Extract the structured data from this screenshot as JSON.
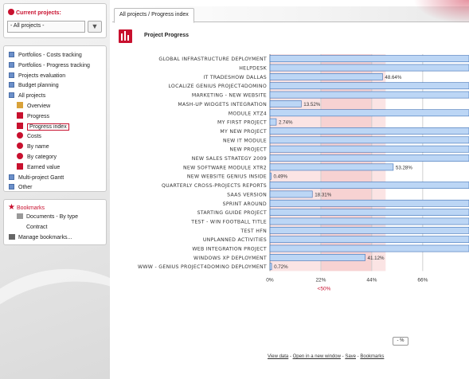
{
  "sidebar": {
    "current_projects_label": "Current projects:",
    "project_select_value": "- All projects -",
    "nav_items": [
      {
        "label": "Portfolios - Costs tracking",
        "level": 0
      },
      {
        "label": "Portfolios - Progress tracking",
        "level": 0
      },
      {
        "label": "Projects evaluation",
        "level": 0
      },
      {
        "label": "Budget planning",
        "level": 0
      },
      {
        "label": "All projects",
        "level": 0
      },
      {
        "label": "Overview",
        "level": 1
      },
      {
        "label": "Progress",
        "level": 1
      },
      {
        "label": "Progress index",
        "level": 1,
        "active": true
      },
      {
        "label": "Costs",
        "level": 1
      },
      {
        "label": "By name",
        "level": 1
      },
      {
        "label": "By category",
        "level": 1
      },
      {
        "label": "Earned value",
        "level": 1
      },
      {
        "label": "Multi-project Gantt",
        "level": 0
      },
      {
        "label": "Other",
        "level": 0
      }
    ],
    "bookmarks_label": "Bookmarks",
    "bookmark_items": [
      {
        "label": "Documents - By type",
        "level": 1
      },
      {
        "label": "Contract",
        "level": 2
      },
      {
        "label": "Manage bookmarks...",
        "level": 0
      }
    ]
  },
  "main": {
    "tab_label": "All projects / Progress index",
    "title": "Project Progress",
    "toggle_label": "- %",
    "links": [
      "View data",
      "Open in a new window",
      "Save",
      "Bookmarks"
    ]
  },
  "chart_data": {
    "type": "bar",
    "orientation": "horizontal",
    "categories": [
      "GLOBAL INFRASTRUCTURE DEPLOYMENT",
      "HELPDESK",
      "IT TRADESHOW DALLAS",
      "LOCALIZE GENIUS PROJECT4DOMINO",
      "MARKETING - NEW WEBSITE",
      "MASH-UP WIDGETS INTEGRATION",
      "MODULE XTZ4",
      "MY FIRST PROJECT",
      "MY NEW PROJECT",
      "NEW IT MODULE",
      "NEW PROJECT",
      "NEW SALES STRATEGY 2009",
      "NEW SOFTWARE MODULE XTR2",
      "NEW WEBSITE GENIUS INSIDE",
      "QUARTERLY CROSS-PROJECTS REPORTS",
      "SAAS VERSION",
      "SPRINT AROUND",
      "STARTING GUIDE PROJECT",
      "TEST - WIN FOOTBALL TITLE",
      "TEST HFN",
      "UNPLANNED ACTIVITIES",
      "WEB INTEGRATION PROJECT",
      "WINDOWS XP DEPLOYMENT",
      "WWW - GENIUS PROJECT4DOMINO DEPLOYMENT"
    ],
    "values": [
      100,
      100,
      48.64,
      100,
      100,
      13.52,
      100,
      2.74,
      100,
      100,
      100,
      100,
      53.28,
      0.49,
      100,
      18.31,
      100,
      100,
      100,
      100,
      100,
      100,
      41.12,
      0.72
    ],
    "data_labels": [
      "",
      "",
      "48.64%",
      "",
      "",
      "13.52%",
      "",
      "2.74%",
      "",
      "",
      "",
      "",
      "53.28%",
      "0.49%",
      "",
      "18.31%",
      "",
      "",
      "",
      "",
      "",
      "",
      "41.12%",
      "0.72%"
    ],
    "x_ticks": [
      "0%",
      "22%",
      "44%",
      "66%"
    ],
    "x_tick_values": [
      0,
      22,
      44,
      66
    ],
    "xlim": [
      0,
      86
    ],
    "threshold_label": "<50%",
    "threshold_value": 50,
    "band_colors": [
      "#fbe4e4",
      "#f7d2d2",
      "#f0f0f0"
    ],
    "bar_color": "#bcd6f5",
    "bar_border_color": "#3b6eb4",
    "threshold_color": "#c8102e"
  }
}
